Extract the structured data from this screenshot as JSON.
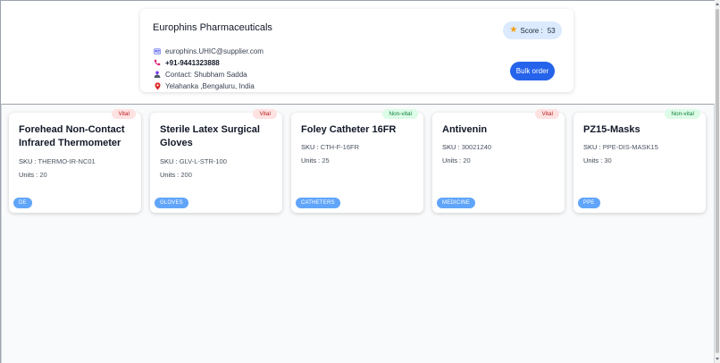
{
  "supplier": {
    "name": "Europhins Pharmaceuticals",
    "email": "europhins.UHIC@supplier.com",
    "phone": "+91-9441323888",
    "contact": "Contact: Shubham Sadda",
    "location": "Yelahanka ,Bengaluru, India",
    "score_label": "Score :",
    "score_value": "53",
    "bulk_order_label": "Bulk order"
  },
  "icons": {
    "email": "id-card-icon",
    "phone": "phone-icon",
    "contact": "person-icon",
    "location": "location-pin-icon",
    "score": "star-icon"
  },
  "colors": {
    "accent": "#2563eb",
    "score_bg": "#dbeafe",
    "vital_bg": "#fee2e2",
    "vital_text": "#b91c1c",
    "nonvital_bg": "#dcfce7",
    "nonvital_text": "#15803d",
    "category_bg": "#60a5fa"
  },
  "products": [
    {
      "title": "Forehead Non-Contact Infrared Thermometer",
      "status": "Vital",
      "sku_label": "SKU :",
      "sku": "THERMO-IR-NC01",
      "units_label": "Units :",
      "units": "20",
      "category": "DE"
    },
    {
      "title": "Sterile Latex Surgical Gloves",
      "status": "Vital",
      "sku_label": "SKU :",
      "sku": "GLV-L-STR-100",
      "units_label": "Units :",
      "units": "200",
      "category": "GLOVES"
    },
    {
      "title": "Foley Catheter 16FR",
      "status": "Non-vital",
      "sku_label": "SKU :",
      "sku": "CTH-F-16FR",
      "units_label": "Units :",
      "units": "25",
      "category": "CATHETERS"
    },
    {
      "title": "Antivenin",
      "status": "Vital",
      "sku_label": "SKU :",
      "sku": "30021240",
      "units_label": "Units :",
      "units": "20",
      "category": "MEDICINE"
    },
    {
      "title": "PZ15-Masks",
      "status": "Non-vital",
      "sku_label": "SKU :",
      "sku": "PPE-DIS-MASK15",
      "units_label": "Units :",
      "units": "30",
      "category": "PPE"
    }
  ]
}
